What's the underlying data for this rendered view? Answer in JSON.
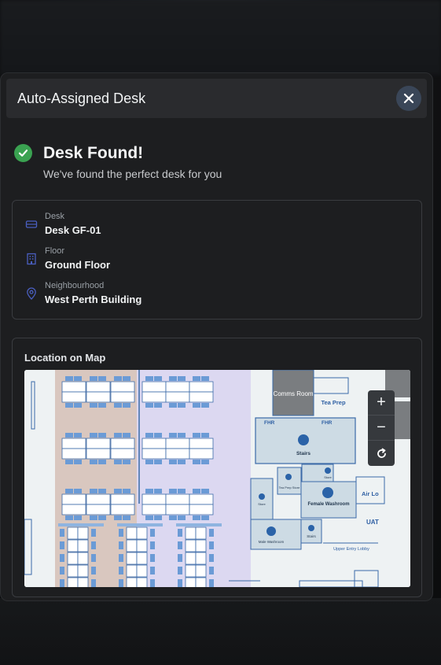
{
  "modal": {
    "title": "Auto-Assigned Desk",
    "close_icon": "close-icon"
  },
  "status": {
    "icon": "check-circle-icon",
    "title": "Desk Found!",
    "subtitle": "We've found the perfect desk for you",
    "color": "#3aa251"
  },
  "details": [
    {
      "icon": "desk-icon",
      "label": "Desk",
      "value": "Desk GF-01"
    },
    {
      "icon": "building-icon",
      "label": "Floor",
      "value": "Ground Floor"
    },
    {
      "icon": "location-pin-icon",
      "label": "Neighbourhood",
      "value": "West Perth Building"
    }
  ],
  "map": {
    "title": "Location on Map",
    "rooms": {
      "comms": "Comms Room",
      "tea_prep": "Tea Prep",
      "fhr_left": "FHR",
      "fhr_right": "FHR",
      "stairs_main": "Stairs",
      "tea_prep_store": "Tea Prep Store",
      "store_top": "Store",
      "store_left": "Store",
      "female_washroom": "Female Washroom",
      "male_washroom": "Male Washroom",
      "stairs_small": "Stairs",
      "air_lock": "Air Lo",
      "uat": "UAT",
      "upper_entry_lobby": "Upper Entry Lobby"
    },
    "controls": {
      "zoom_in": "+",
      "zoom_out": "−",
      "reset_icon": "refresh-icon"
    }
  },
  "colors": {
    "accent": "#1f6fb5",
    "neighbourhood_a": "#d9c7bf",
    "neighbourhood_b": "#dcd8f1"
  }
}
